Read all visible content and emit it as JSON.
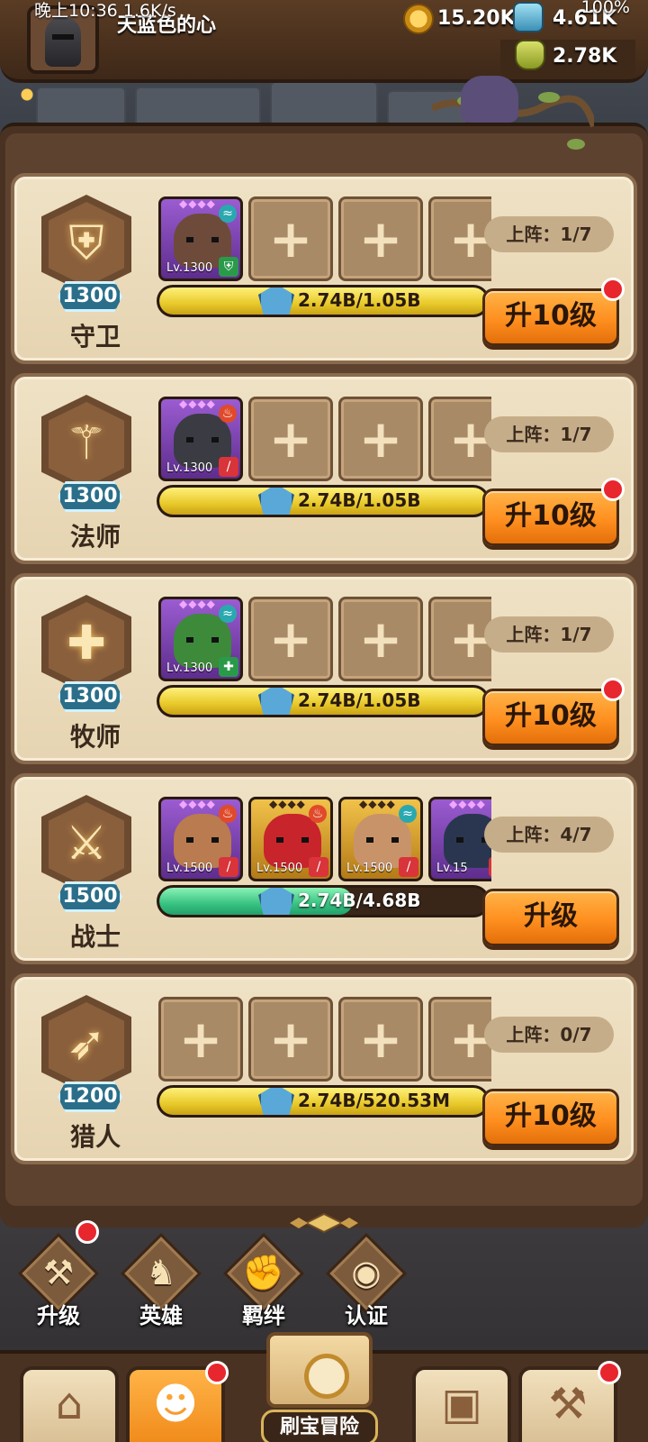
{
  "status_bar": {
    "time": "晚上10:36 1.6K/s",
    "battery": "100%"
  },
  "player": {
    "name": "天蓝色的心",
    "resources": [
      {
        "name": "coin",
        "value": "15.20K",
        "icon": "gold-coin-icon",
        "color": "#e0a526"
      },
      {
        "name": "gem",
        "value": "4.61K",
        "icon": "blue-gem-icon",
        "color": "#5fb4d6"
      },
      {
        "name": "potion",
        "value": "2.78K",
        "icon": "potion-icon",
        "color": "#c7d24a"
      }
    ]
  },
  "classes": [
    {
      "name": "守卫",
      "level": "1300",
      "icon": "shield-icon",
      "glyph": "⛨",
      "deploy": "上阵：1/7",
      "heroes": [
        {
          "lv": "Lv.1300",
          "rarity": "purple",
          "face_color": "#6e4a3a",
          "element": "wind",
          "tag": "shield"
        }
      ],
      "empty_slots": 3,
      "progress": {
        "text": "2.74B/1.05B",
        "fill": 1.0,
        "color": "yellow"
      },
      "button": "升10级",
      "notify": true
    },
    {
      "name": "法师",
      "level": "1300",
      "icon": "staff-icon",
      "glyph": "⚚",
      "deploy": "上阵：1/7",
      "heroes": [
        {
          "lv": "Lv.1300",
          "rarity": "purple",
          "face_color": "#3b3b44",
          "element": "fire",
          "tag": "magic"
        }
      ],
      "empty_slots": 3,
      "progress": {
        "text": "2.74B/1.05B",
        "fill": 1.0,
        "color": "yellow"
      },
      "button": "升10级",
      "notify": true
    },
    {
      "name": "牧师",
      "level": "1300",
      "icon": "cross-icon",
      "glyph": "✚",
      "deploy": "上阵：1/7",
      "heroes": [
        {
          "lv": "Lv.1300",
          "rarity": "purple",
          "face_color": "#3d8a3a",
          "element": "wind",
          "tag": "heal"
        }
      ],
      "empty_slots": 3,
      "progress": {
        "text": "2.74B/1.05B",
        "fill": 1.0,
        "color": "yellow"
      },
      "button": "升10级",
      "notify": true
    },
    {
      "name": "战士",
      "level": "1500",
      "icon": "sword-icon",
      "glyph": "⚔",
      "deploy": "上阵：4/7",
      "heroes": [
        {
          "lv": "Lv.1500",
          "rarity": "purple",
          "face_color": "#b97b4f",
          "element": "fire",
          "tag": "sword"
        },
        {
          "lv": "Lv.1500",
          "rarity": "gold",
          "face_color": "#c8242b",
          "element": "fire",
          "tag": "sword"
        },
        {
          "lv": "Lv.1500",
          "rarity": "gold",
          "face_color": "#c9936a",
          "element": "wind",
          "tag": "sword"
        },
        {
          "lv": "Lv.15",
          "rarity": "purple",
          "face_color": "#2a3650",
          "element": "none",
          "tag": "sword"
        }
      ],
      "empty_slots": 0,
      "progress": {
        "text": "2.74B/4.68B",
        "fill": 0.59,
        "color": "green"
      },
      "button": "升级",
      "notify": false
    },
    {
      "name": "猎人",
      "level": "1200",
      "icon": "bow-icon",
      "glyph": "➶",
      "deploy": "上阵：0/7",
      "heroes": [],
      "empty_slots": 4,
      "progress": {
        "text": "2.74B/520.53M",
        "fill": 1.0,
        "color": "yellow"
      },
      "button": "升10级",
      "notify": false
    }
  ],
  "tabs": [
    {
      "label": "升级",
      "icon": "sword-hammer-icon",
      "glyph": "⚒",
      "notify": true
    },
    {
      "label": "英雄",
      "icon": "hero-icon",
      "glyph": "♞",
      "notify": false
    },
    {
      "label": "羁绊",
      "icon": "fist-icon",
      "glyph": "✊",
      "notify": false
    },
    {
      "label": "认证",
      "icon": "eye-icon",
      "glyph": "◉",
      "notify": false
    }
  ],
  "nav": {
    "items": [
      {
        "icon": "shop-icon",
        "glyph": "⌂",
        "active": false,
        "notify": false
      },
      {
        "icon": "hero-portrait-icon",
        "glyph": "☻",
        "active": true,
        "notify": true
      },
      {
        "icon": "backpack-icon",
        "glyph": "▣",
        "active": false,
        "notify": false
      },
      {
        "icon": "forge-icon",
        "glyph": "⚒",
        "active": false,
        "notify": true
      }
    ],
    "center_label": "刷宝冒险"
  }
}
